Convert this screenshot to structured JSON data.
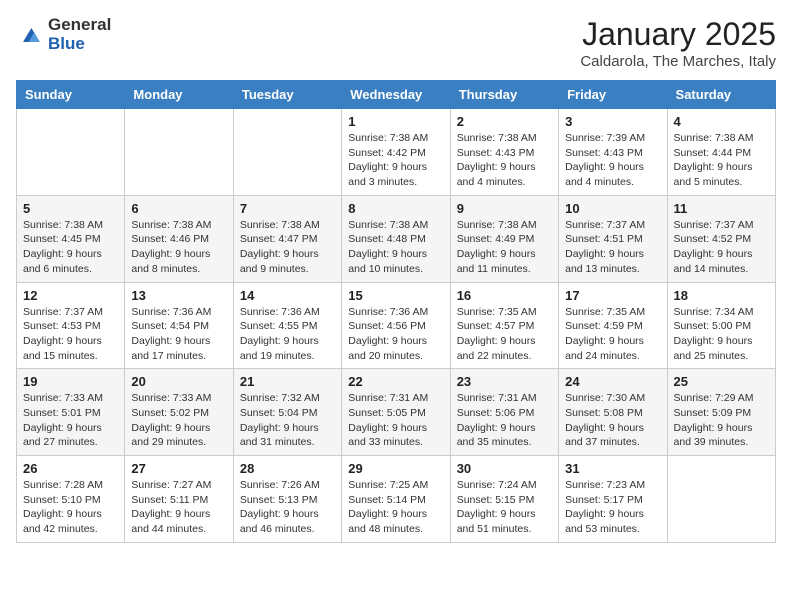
{
  "header": {
    "logo_general": "General",
    "logo_blue": "Blue",
    "month_title": "January 2025",
    "location": "Caldarola, The Marches, Italy"
  },
  "weekdays": [
    "Sunday",
    "Monday",
    "Tuesday",
    "Wednesday",
    "Thursday",
    "Friday",
    "Saturday"
  ],
  "weeks": [
    [
      {
        "day": "",
        "info": ""
      },
      {
        "day": "",
        "info": ""
      },
      {
        "day": "",
        "info": ""
      },
      {
        "day": "1",
        "info": "Sunrise: 7:38 AM\nSunset: 4:42 PM\nDaylight: 9 hours and 3 minutes."
      },
      {
        "day": "2",
        "info": "Sunrise: 7:38 AM\nSunset: 4:43 PM\nDaylight: 9 hours and 4 minutes."
      },
      {
        "day": "3",
        "info": "Sunrise: 7:39 AM\nSunset: 4:43 PM\nDaylight: 9 hours and 4 minutes."
      },
      {
        "day": "4",
        "info": "Sunrise: 7:38 AM\nSunset: 4:44 PM\nDaylight: 9 hours and 5 minutes."
      }
    ],
    [
      {
        "day": "5",
        "info": "Sunrise: 7:38 AM\nSunset: 4:45 PM\nDaylight: 9 hours and 6 minutes."
      },
      {
        "day": "6",
        "info": "Sunrise: 7:38 AM\nSunset: 4:46 PM\nDaylight: 9 hours and 8 minutes."
      },
      {
        "day": "7",
        "info": "Sunrise: 7:38 AM\nSunset: 4:47 PM\nDaylight: 9 hours and 9 minutes."
      },
      {
        "day": "8",
        "info": "Sunrise: 7:38 AM\nSunset: 4:48 PM\nDaylight: 9 hours and 10 minutes."
      },
      {
        "day": "9",
        "info": "Sunrise: 7:38 AM\nSunset: 4:49 PM\nDaylight: 9 hours and 11 minutes."
      },
      {
        "day": "10",
        "info": "Sunrise: 7:37 AM\nSunset: 4:51 PM\nDaylight: 9 hours and 13 minutes."
      },
      {
        "day": "11",
        "info": "Sunrise: 7:37 AM\nSunset: 4:52 PM\nDaylight: 9 hours and 14 minutes."
      }
    ],
    [
      {
        "day": "12",
        "info": "Sunrise: 7:37 AM\nSunset: 4:53 PM\nDaylight: 9 hours and 15 minutes."
      },
      {
        "day": "13",
        "info": "Sunrise: 7:36 AM\nSunset: 4:54 PM\nDaylight: 9 hours and 17 minutes."
      },
      {
        "day": "14",
        "info": "Sunrise: 7:36 AM\nSunset: 4:55 PM\nDaylight: 9 hours and 19 minutes."
      },
      {
        "day": "15",
        "info": "Sunrise: 7:36 AM\nSunset: 4:56 PM\nDaylight: 9 hours and 20 minutes."
      },
      {
        "day": "16",
        "info": "Sunrise: 7:35 AM\nSunset: 4:57 PM\nDaylight: 9 hours and 22 minutes."
      },
      {
        "day": "17",
        "info": "Sunrise: 7:35 AM\nSunset: 4:59 PM\nDaylight: 9 hours and 24 minutes."
      },
      {
        "day": "18",
        "info": "Sunrise: 7:34 AM\nSunset: 5:00 PM\nDaylight: 9 hours and 25 minutes."
      }
    ],
    [
      {
        "day": "19",
        "info": "Sunrise: 7:33 AM\nSunset: 5:01 PM\nDaylight: 9 hours and 27 minutes."
      },
      {
        "day": "20",
        "info": "Sunrise: 7:33 AM\nSunset: 5:02 PM\nDaylight: 9 hours and 29 minutes."
      },
      {
        "day": "21",
        "info": "Sunrise: 7:32 AM\nSunset: 5:04 PM\nDaylight: 9 hours and 31 minutes."
      },
      {
        "day": "22",
        "info": "Sunrise: 7:31 AM\nSunset: 5:05 PM\nDaylight: 9 hours and 33 minutes."
      },
      {
        "day": "23",
        "info": "Sunrise: 7:31 AM\nSunset: 5:06 PM\nDaylight: 9 hours and 35 minutes."
      },
      {
        "day": "24",
        "info": "Sunrise: 7:30 AM\nSunset: 5:08 PM\nDaylight: 9 hours and 37 minutes."
      },
      {
        "day": "25",
        "info": "Sunrise: 7:29 AM\nSunset: 5:09 PM\nDaylight: 9 hours and 39 minutes."
      }
    ],
    [
      {
        "day": "26",
        "info": "Sunrise: 7:28 AM\nSunset: 5:10 PM\nDaylight: 9 hours and 42 minutes."
      },
      {
        "day": "27",
        "info": "Sunrise: 7:27 AM\nSunset: 5:11 PM\nDaylight: 9 hours and 44 minutes."
      },
      {
        "day": "28",
        "info": "Sunrise: 7:26 AM\nSunset: 5:13 PM\nDaylight: 9 hours and 46 minutes."
      },
      {
        "day": "29",
        "info": "Sunrise: 7:25 AM\nSunset: 5:14 PM\nDaylight: 9 hours and 48 minutes."
      },
      {
        "day": "30",
        "info": "Sunrise: 7:24 AM\nSunset: 5:15 PM\nDaylight: 9 hours and 51 minutes."
      },
      {
        "day": "31",
        "info": "Sunrise: 7:23 AM\nSunset: 5:17 PM\nDaylight: 9 hours and 53 minutes."
      },
      {
        "day": "",
        "info": ""
      }
    ]
  ]
}
